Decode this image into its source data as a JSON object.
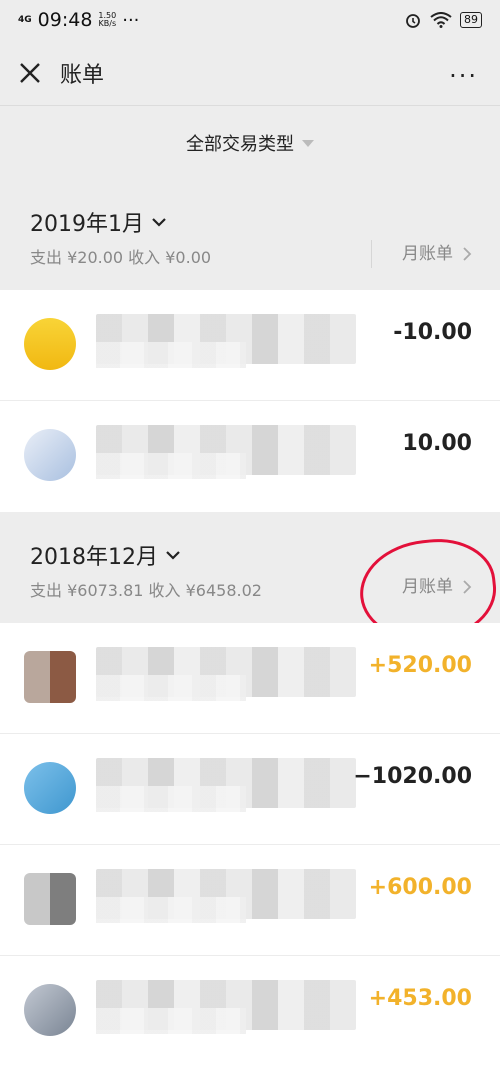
{
  "status_bar": {
    "network": "4G",
    "time": "09:48",
    "speed_value": "1.50",
    "speed_unit": "KB/s",
    "dots": "···",
    "battery": "89"
  },
  "navbar": {
    "title": "账单",
    "more": "···"
  },
  "filter": {
    "label": "全部交易类型"
  },
  "months": [
    {
      "title": "2019年1月",
      "summary": "支出 ¥20.00 收入 ¥0.00",
      "bill_label": "月账单",
      "transactions": [
        {
          "amount": "-10.00",
          "type": "out",
          "avatar_color": "#f4c21c"
        },
        {
          "amount": "10.00",
          "type": "out",
          "avatar_color": "#c9d6ea"
        }
      ]
    },
    {
      "title": "2018年12月",
      "summary": "支出 ¥6073.81 收入 ¥6458.02",
      "bill_label": "月账单",
      "transactions": [
        {
          "amount": "+520.00",
          "type": "in",
          "avatar_color": "#8c6a5a"
        },
        {
          "amount": "−1020.00",
          "type": "out",
          "avatar_color": "#5aa7d6"
        },
        {
          "amount": "+600.00",
          "type": "in",
          "avatar_color": "#8a8a8a"
        },
        {
          "amount": "+453.00",
          "type": "in",
          "avatar_color": "#9aa3b0"
        }
      ]
    }
  ],
  "colors": {
    "income": "#f2b22b",
    "highlight_circle": "#e3103a"
  }
}
